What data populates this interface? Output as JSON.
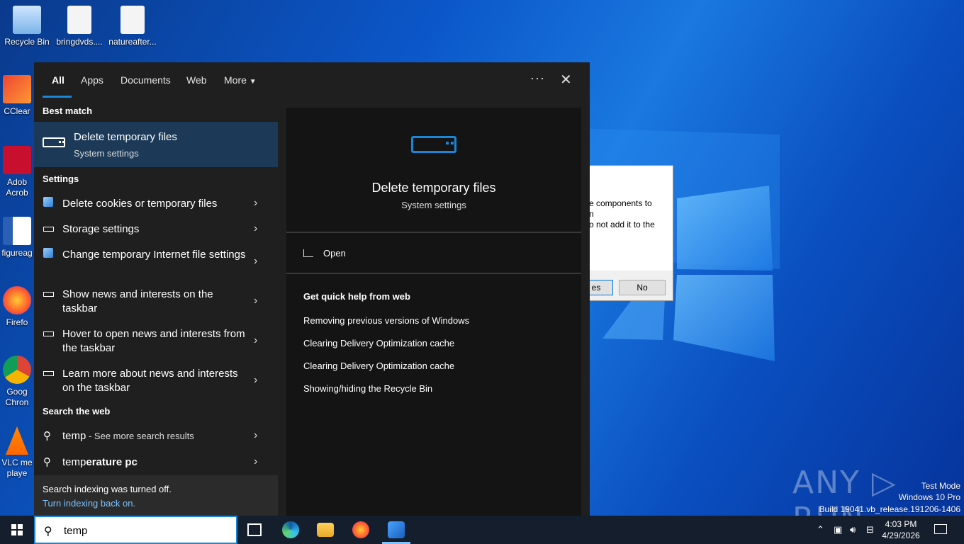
{
  "desktop": {
    "icons": [
      {
        "label": "Recycle Bin",
        "icon": "recycle-bin-icon"
      },
      {
        "label": "bringdvds....",
        "icon": "image-file-icon"
      },
      {
        "label": "natureafter...",
        "icon": "image-file-icon"
      },
      {
        "label": "CClear",
        "icon": "ccleaner-icon"
      },
      {
        "label": "Adob Acrob",
        "icon": "acrobat-icon"
      },
      {
        "label": "figureag",
        "icon": "word-doc-icon"
      },
      {
        "label": "Firefo",
        "icon": "firefox-icon"
      },
      {
        "label": "Goog Chron",
        "icon": "chrome-icon"
      },
      {
        "label": "VLC me playe",
        "icon": "vlc-icon"
      }
    ],
    "dialog": {
      "text_line1": "e components to",
      "text_line2": "n",
      "text_line3": "o not add it to the",
      "yes_label": "es",
      "no_label": "No"
    },
    "watermark": {
      "logo": "ANY ▷ RUN",
      "line1": "Test Mode",
      "line2": "Windows 10 Pro",
      "line3": "Build 19041.vb_release.191206-1406"
    }
  },
  "search_panel": {
    "tabs": [
      "All",
      "Apps",
      "Documents",
      "Web",
      "More"
    ],
    "more_menu": "···",
    "sections": {
      "best_match": "Best match",
      "settings": "Settings",
      "search_web": "Search the web"
    },
    "best_match": {
      "title": "Delete temporary files",
      "subtitle": "System settings"
    },
    "settings_items": [
      {
        "label": "Delete cookies or temporary files",
        "icon": "internet-options-icon"
      },
      {
        "label": "Storage settings",
        "icon": "storage-icon"
      },
      {
        "label": "Change temporary Internet file settings",
        "icon": "internet-options-icon"
      },
      {
        "label": "Show news and interests on the taskbar",
        "icon": "taskbar-icon"
      },
      {
        "label": "Hover to open news and interests from the taskbar",
        "icon": "taskbar-icon"
      },
      {
        "label": "Learn more about news and interests on the taskbar",
        "icon": "taskbar-icon"
      }
    ],
    "web_items": [
      {
        "bold": "temp",
        "rest": " - See more search results"
      },
      {
        "normal": "temp",
        "bold": "erature pc"
      }
    ],
    "indexing": {
      "message": "Search indexing was turned off.",
      "link": "Turn indexing back on."
    },
    "preview": {
      "title": "Delete temporary files",
      "subtitle": "System settings",
      "open_label": "Open",
      "quick_help_title": "Get quick help from web",
      "links": [
        "Removing previous versions of Windows",
        "Clearing Delivery Optimization cache",
        "Clearing Delivery Optimization cache",
        "Showing/hiding the Recycle Bin"
      ]
    }
  },
  "taskbar": {
    "search_value": "temp",
    "time": "4:03 PM",
    "date": "4/29/2026",
    "colors": {
      "accent": "#1a86d9",
      "taskbar_bg": "#141e2c"
    }
  }
}
